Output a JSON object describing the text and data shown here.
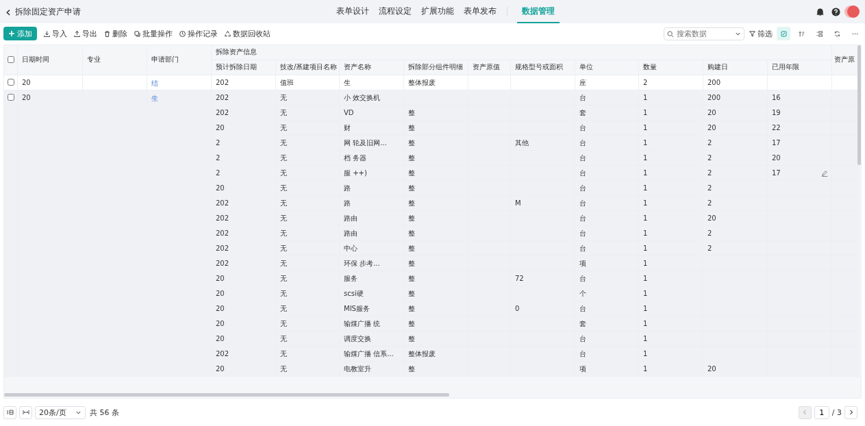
{
  "header": {
    "back": "‹",
    "title": "拆除固定资产申请",
    "tabs": [
      {
        "label": "表单设计",
        "selected": false
      },
      {
        "label": "流程设定",
        "selected": false
      },
      {
        "label": "扩展功能",
        "selected": false
      },
      {
        "label": "表单发布",
        "selected": false
      },
      {
        "label": "数据管理",
        "selected": true
      }
    ]
  },
  "toolbar": {
    "add": "添加",
    "actions": [
      {
        "kind": "import",
        "label": "导入"
      },
      {
        "kind": "export",
        "label": "导出"
      },
      {
        "kind": "delete",
        "label": "删除"
      },
      {
        "kind": "batch",
        "label": "批量操作"
      },
      {
        "kind": "log",
        "label": "操作记录"
      },
      {
        "kind": "recycle",
        "label": "数据回收站"
      }
    ],
    "search": {
      "placeholder": "搜索数据"
    },
    "filter": "筛选",
    "view_buttons": [
      {
        "kind": "card",
        "selected": true
      },
      {
        "kind": "sort",
        "selected": false
      },
      {
        "kind": "group",
        "selected": false
      },
      {
        "kind": "refresh",
        "selected": false
      },
      {
        "kind": "more",
        "selected": false
      }
    ]
  },
  "table": {
    "all_checked": false,
    "columns": [
      "日期时间",
      "专业",
      "申请部门"
    ],
    "group": "拆除资产信息",
    "group_columns": [
      "预计拆除日期",
      "技改/基建项目名称",
      "资产名称",
      "拆除部分组件明细",
      "资产原值",
      "规格型号或面积",
      "单位",
      "数量",
      "购建日",
      "已用年限"
    ],
    "last_column": "资产原",
    "records": [
      {
        "date": "20",
        "dept": "结",
        "checked": false,
        "hovered": false,
        "items": [
          {
            "planned": "202",
            "project": "值班",
            "asset": "生",
            "parts": "整体报废",
            "unit": "座",
            "qty": "2",
            "built": "200"
          }
        ]
      },
      {
        "date": "20",
        "dept": "生",
        "checked": false,
        "hovered": true,
        "items": [
          {
            "planned": "202",
            "project": "无",
            "asset": "小 效交换机",
            "unit": "台",
            "qty": "1",
            "built": "200",
            "years": "16"
          },
          {
            "planned": "202",
            "project": "无",
            "asset": "VD",
            "parts": "整",
            "unit": "套",
            "qty": "1",
            "built": "20",
            "years": "19"
          },
          {
            "planned": "20",
            "project": "无",
            "asset": "财",
            "parts": "整",
            "unit": "台",
            "qty": "1",
            "built": "20",
            "years": "22"
          },
          {
            "planned": "2",
            "project": "无",
            "asset": "网 轮及旧网...",
            "parts": "整",
            "spec": "其他",
            "unit": "台",
            "qty": "1",
            "built": "2",
            "years": "17"
          },
          {
            "planned": "2",
            "project": "无",
            "asset": "档 务器",
            "parts": "整",
            "unit": "台",
            "qty": "1",
            "built": "2",
            "years": "20"
          },
          {
            "planned": "2",
            "project": "无",
            "asset": "服 ++)",
            "parts": "整",
            "unit": "台",
            "qty": "1",
            "built": "2",
            "years": "17",
            "edit": true
          },
          {
            "planned": "20",
            "project": "无",
            "asset": "路",
            "parts": "整",
            "unit": "台",
            "qty": "1",
            "built": "2"
          },
          {
            "planned": "202",
            "project": "无",
            "asset": "路",
            "parts": "整",
            "spec": "M",
            "unit": "台",
            "qty": "1",
            "built": "2"
          },
          {
            "planned": "202",
            "project": "无",
            "asset": "路由",
            "parts": "整",
            "unit": "台",
            "qty": "1",
            "built": "20"
          },
          {
            "planned": "202",
            "project": "无",
            "asset": "路由",
            "parts": "整",
            "unit": "台",
            "qty": "1",
            "built": "2"
          },
          {
            "planned": "202",
            "project": "无",
            "asset": "中心",
            "parts": "整",
            "unit": "台",
            "qty": "1",
            "built": "2"
          },
          {
            "planned": "202",
            "project": "无",
            "asset": "环保 步考...",
            "parts": "整",
            "unit": "项",
            "qty": "1"
          },
          {
            "planned": "20",
            "project": "无",
            "asset": "服务",
            "parts": "整",
            "spec": "72",
            "unit": "台",
            "qty": "1"
          },
          {
            "planned": "20",
            "project": "无",
            "asset": "scsi硬",
            "parts": "整",
            "unit": "个",
            "qty": "1"
          },
          {
            "planned": "20",
            "project": "无",
            "asset": "MIS服务",
            "parts": "整",
            "spec": "0",
            "unit": "台",
            "qty": "1"
          },
          {
            "planned": "20",
            "project": "无",
            "asset": "输煤广播 统",
            "parts": "整",
            "unit": "套",
            "qty": "1"
          },
          {
            "planned": "20",
            "project": "无",
            "asset": "调度交换",
            "parts": "整",
            "unit": "台",
            "qty": "1"
          },
          {
            "planned": "202",
            "project": "无",
            "asset": "输煤广播 信系...",
            "parts": "整体报废",
            "unit": "台",
            "qty": "1"
          },
          {
            "planned": "20",
            "project": "无",
            "asset": "电教室升",
            "parts": "整",
            "unit": "项",
            "qty": "1",
            "built": "20"
          }
        ]
      }
    ]
  },
  "footer": {
    "page_size": "20条/页",
    "total": "共 56 条",
    "page": "1",
    "pages": "/ 3"
  }
}
